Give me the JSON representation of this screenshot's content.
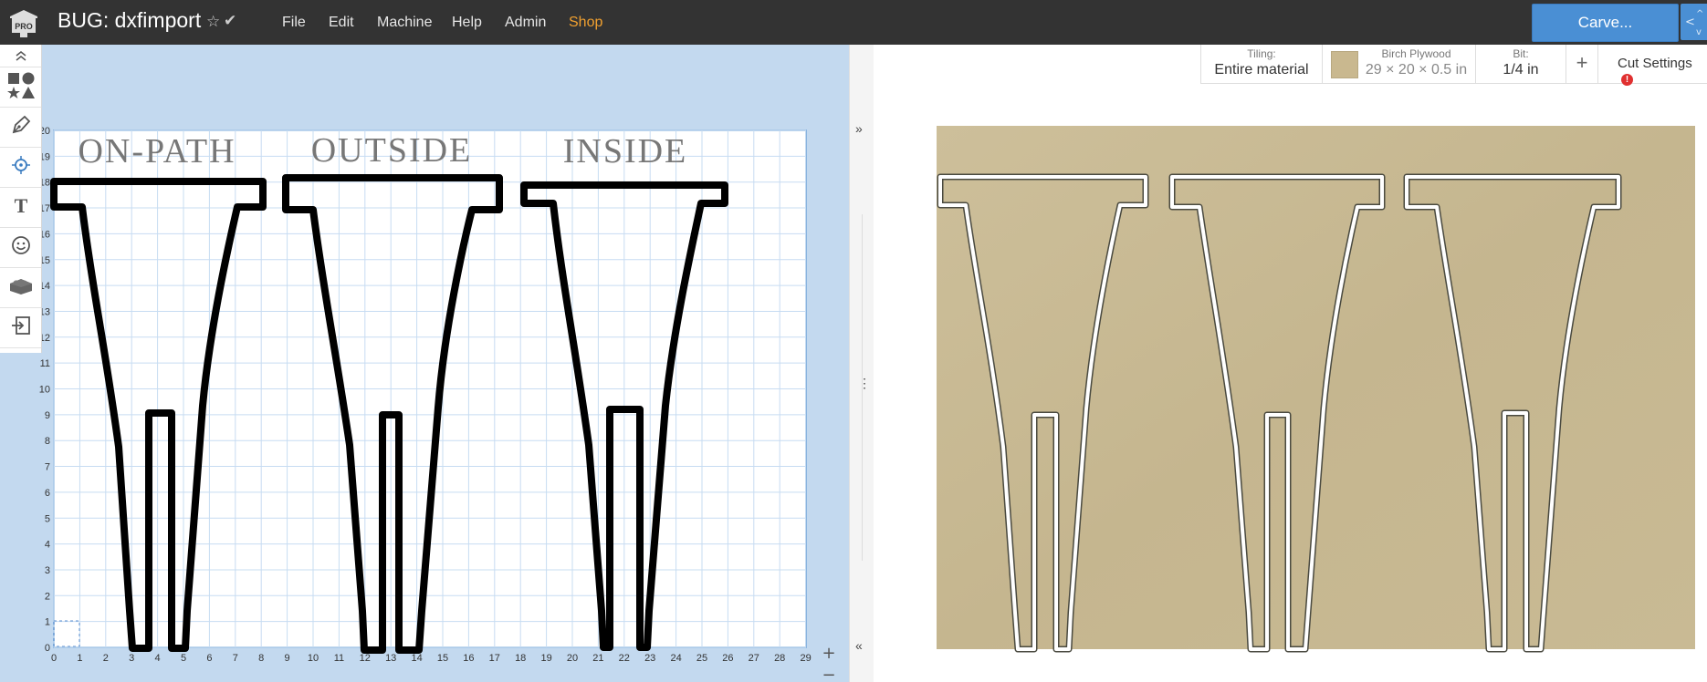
{
  "app": {
    "title": "BUG: dxfimport",
    "star_icon": "☆",
    "check_icon": "✔",
    "pro_badge": "PRO",
    "menu": [
      "File",
      "Edit",
      "Machine",
      "Help",
      "Admin",
      "Shop"
    ],
    "carve_label": "Carve..."
  },
  "design": {
    "labels": [
      "ON-PATH",
      "OUTSIDE",
      "INSIDE"
    ],
    "x_ticks": [
      "0",
      "1",
      "2",
      "3",
      "4",
      "5",
      "6",
      "7",
      "8",
      "9",
      "10",
      "11",
      "12",
      "13",
      "14",
      "15",
      "16",
      "17",
      "18",
      "19",
      "20",
      "21",
      "22",
      "23",
      "24",
      "25",
      "26",
      "27",
      "28",
      "29"
    ],
    "y_ticks": [
      "0",
      "1",
      "2",
      "3",
      "4",
      "5",
      "6",
      "7",
      "8",
      "9",
      "10",
      "11",
      "12",
      "13",
      "14",
      "15",
      "16",
      "17",
      "18",
      "19",
      "20"
    ],
    "zoom_in": "+",
    "zoom_out": "−"
  },
  "settings": {
    "tiling_label": "Tiling:",
    "tiling_value": "Entire material",
    "material_name": "Birch Plywood",
    "material_size": "29 × 20 × 0.5 in",
    "bit_label": "Bit:",
    "bit_value": "1/4 in",
    "add": "+",
    "cut_settings": "Cut Settings",
    "warning": "!"
  },
  "splitter": {
    "collapse_right": "»",
    "drag": "⋮",
    "collapse_left": "«"
  },
  "colors": {
    "topbar": "#333333",
    "canvas_bg": "#c3d9ef",
    "carve": "#4a8fd4",
    "shop": "#f0a030",
    "wood": "#c9b88f"
  }
}
